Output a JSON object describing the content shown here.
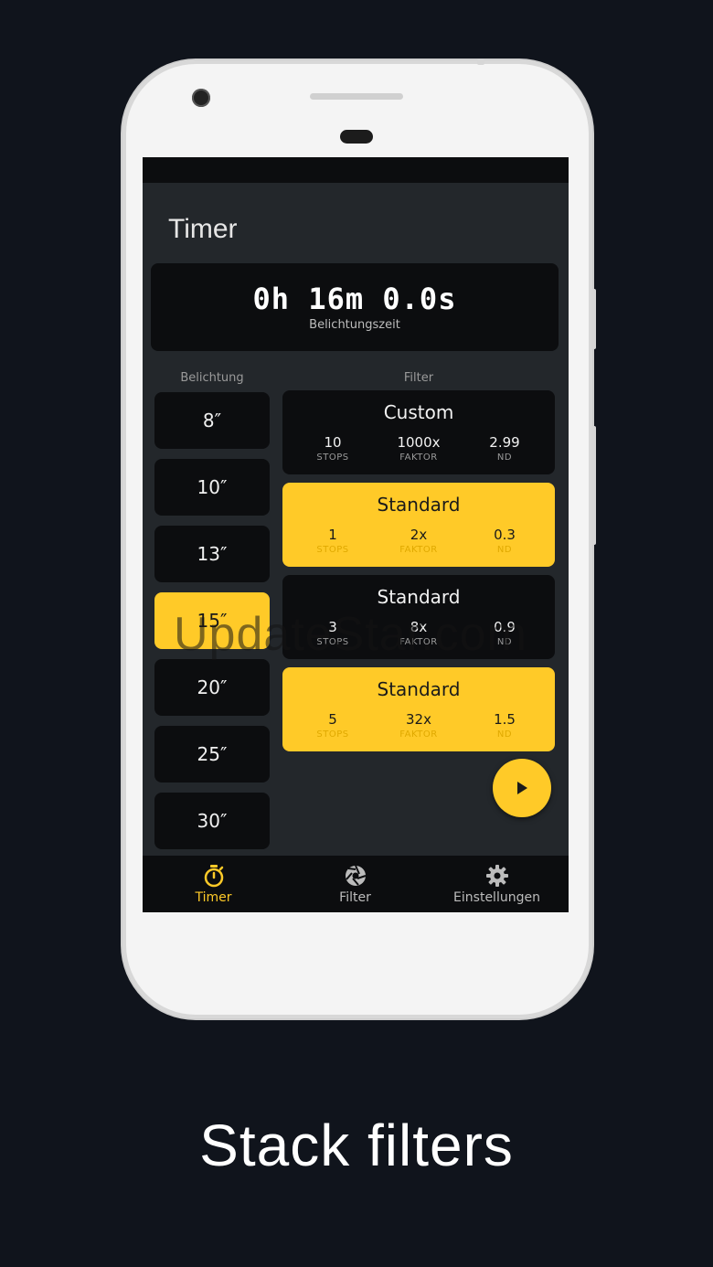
{
  "screen": {
    "title": "Timer",
    "exposure": {
      "value": "0h 16m 0.0s",
      "label": "Belichtungszeit"
    },
    "columns": {
      "exposure": "Belichtung",
      "filter": "Filter"
    },
    "exposure_options": [
      {
        "label": "8″",
        "active": false
      },
      {
        "label": "10″",
        "active": false
      },
      {
        "label": "13″",
        "active": false
      },
      {
        "label": "15″",
        "active": true
      },
      {
        "label": "20″",
        "active": false
      },
      {
        "label": "25″",
        "active": false
      },
      {
        "label": "30″",
        "active": false
      }
    ],
    "filters": [
      {
        "name": "Custom",
        "selected": false,
        "stops": "10",
        "factor": "1000x",
        "nd": "2.99"
      },
      {
        "name": "Standard",
        "selected": true,
        "stops": "1",
        "factor": "2x",
        "nd": "0.3"
      },
      {
        "name": "Standard",
        "selected": false,
        "stops": "3",
        "factor": "8x",
        "nd": "0.9"
      },
      {
        "name": "Standard",
        "selected": true,
        "stops": "5",
        "factor": "32x",
        "nd": "1.5"
      }
    ],
    "stat_labels": {
      "stops": "STOPS",
      "factor": "FAKTOR",
      "nd": "ND"
    },
    "fab_icon": "play-icon",
    "nav": [
      {
        "label": "Timer",
        "icon": "stopwatch-icon",
        "active": true
      },
      {
        "label": "Filter",
        "icon": "aperture-icon",
        "active": false
      },
      {
        "label": "Einstellungen",
        "icon": "gear-icon",
        "active": false
      }
    ]
  },
  "watermark": "UpdateStar.com",
  "caption": "Stack filters",
  "colors": {
    "accent": "#ffca28",
    "background": "#10141c",
    "card": "#0c0d0f",
    "screen": "#23272b"
  }
}
